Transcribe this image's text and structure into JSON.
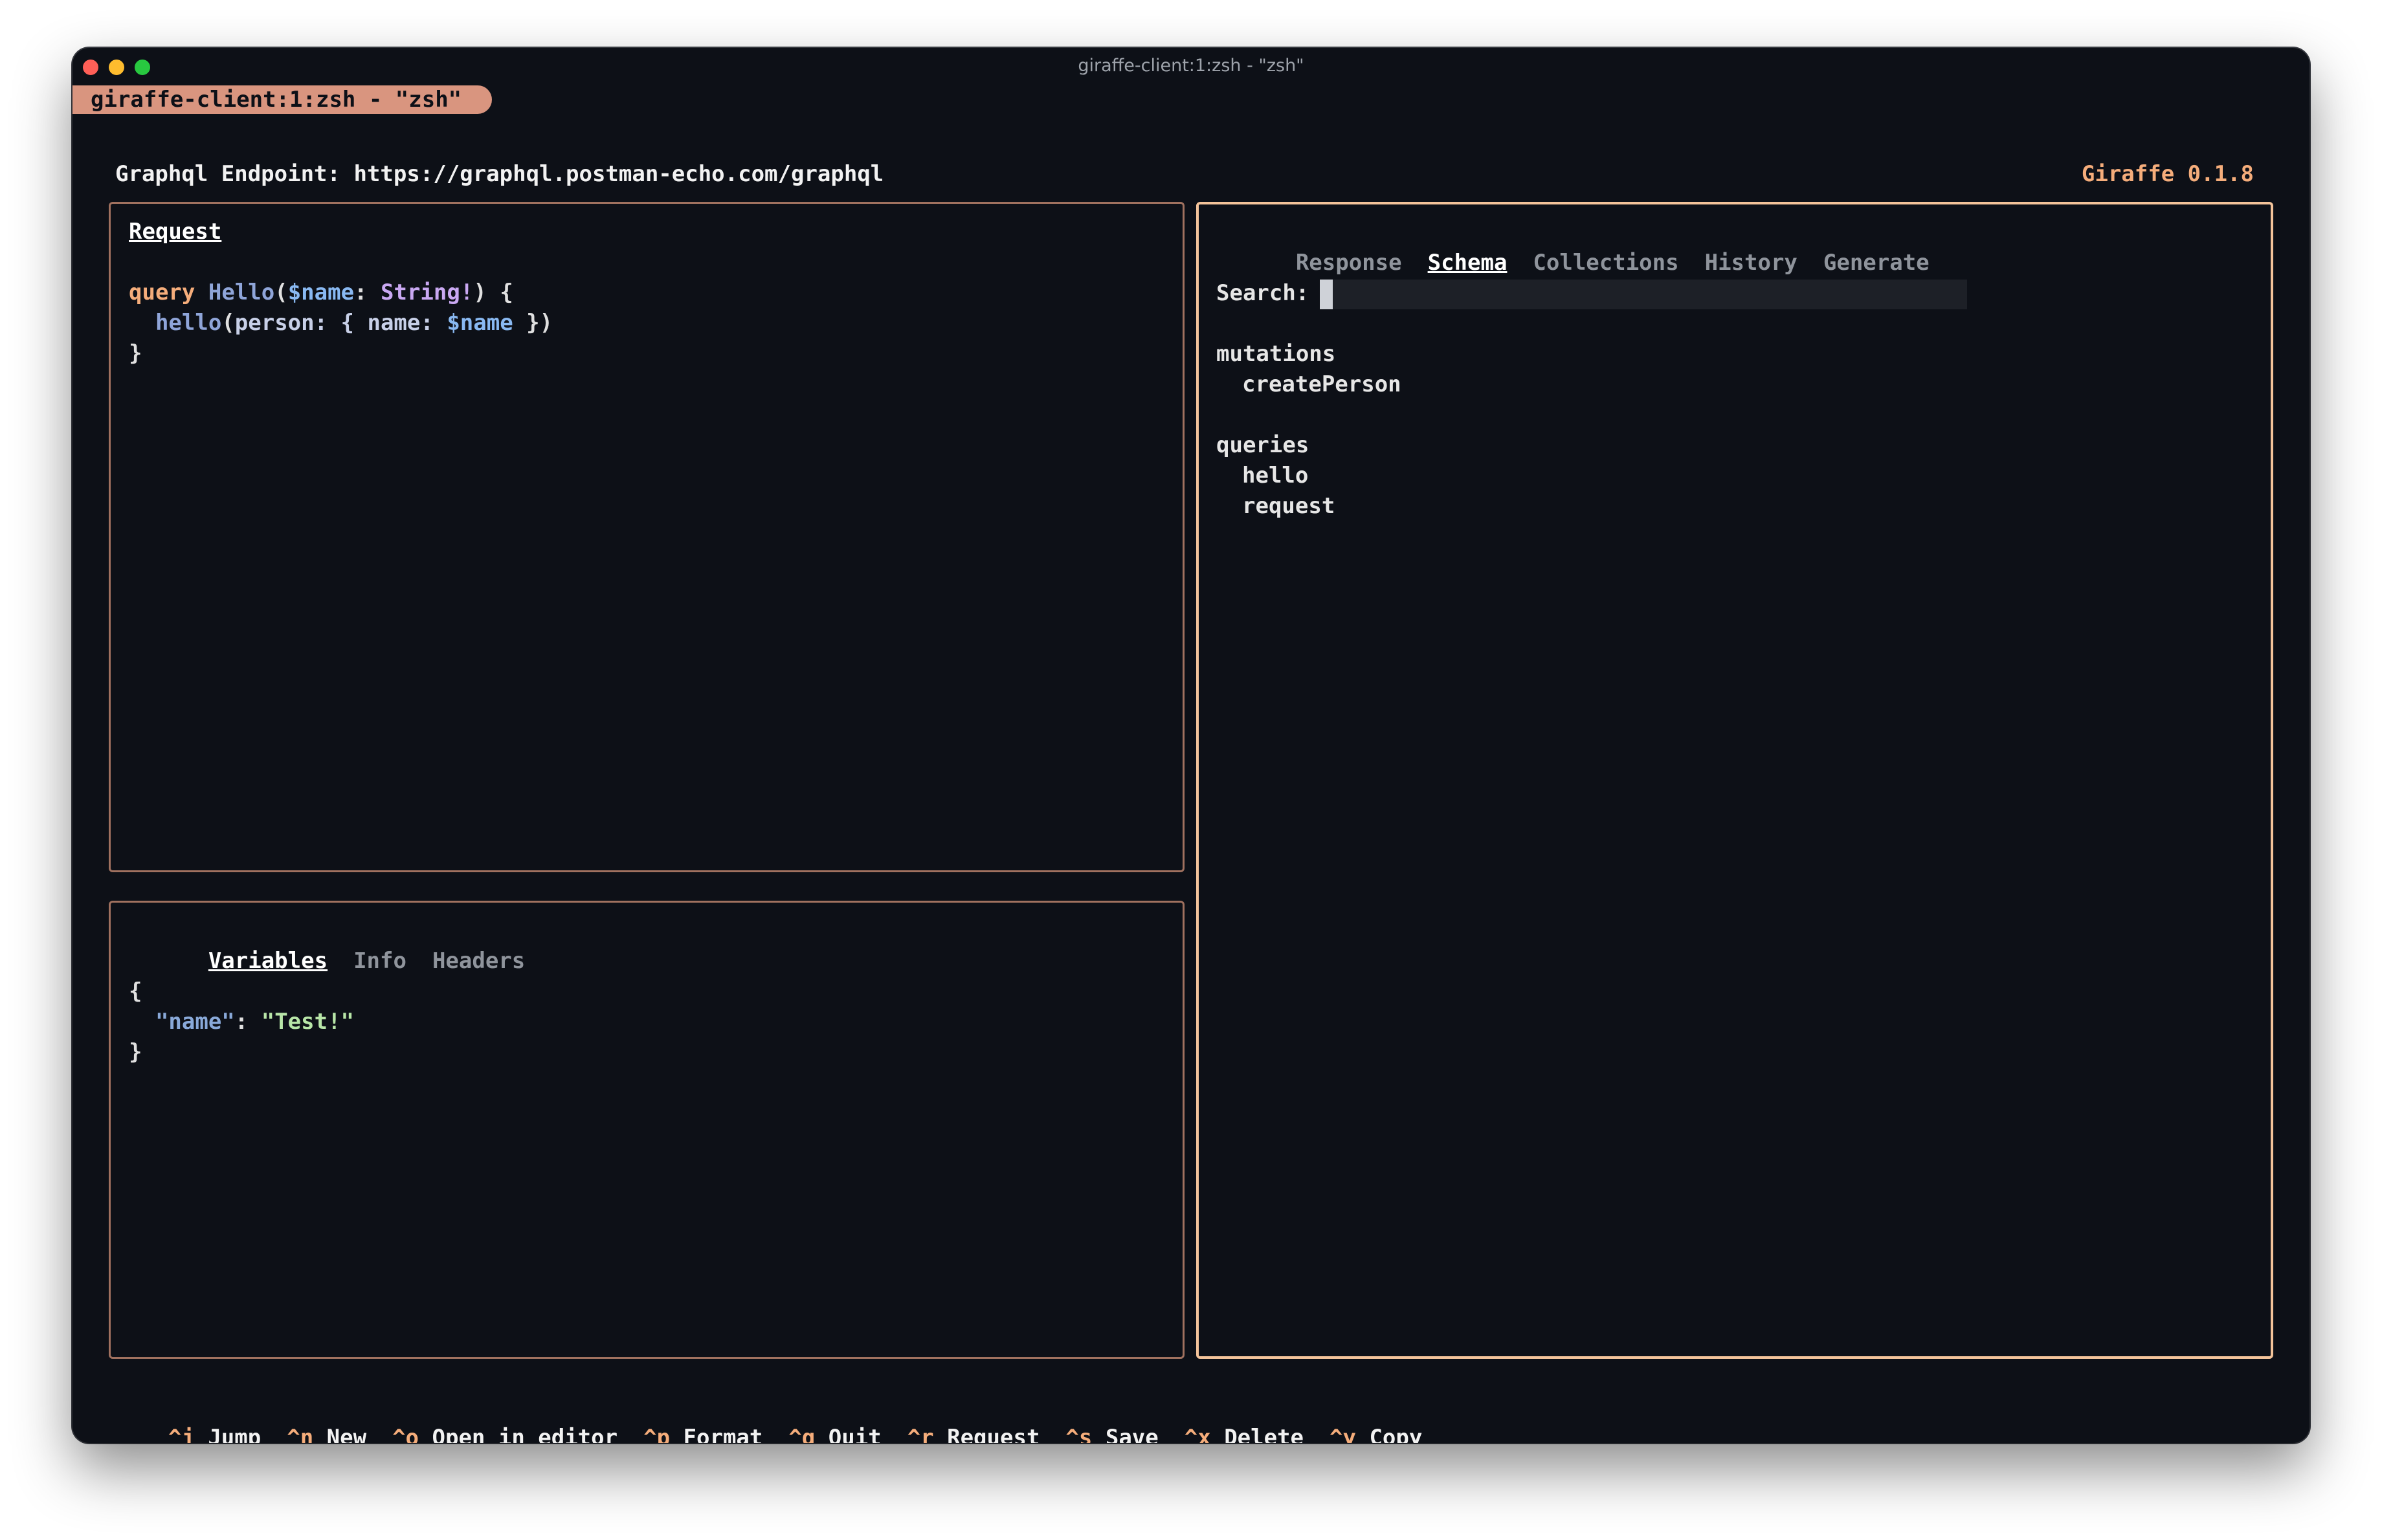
{
  "window": {
    "title": "giraffe-client:1:zsh - \"zsh\""
  },
  "tmux_tab": {
    "label": "giraffe-client:1:zsh - \"zsh\""
  },
  "header": {
    "endpoint_label": "Graphql Endpoint:",
    "endpoint_url": "https://graphql.postman-echo.com/graphql",
    "version": "Giraffe 0.1.8"
  },
  "request": {
    "title": "Request",
    "code": {
      "l1_kw": "query",
      "l1_name": "Hello",
      "l1_paren": "(",
      "l1_var": "$name",
      "l1_colon": ": ",
      "l1_type": "String!",
      "l1_close": ") {",
      "l2_field": "hello",
      "l2_paren": "(",
      "l2_arg": "person: { name: ",
      "l2_var": "$name",
      "l2_close": " })",
      "l3": "}"
    }
  },
  "variables": {
    "tabs": [
      "Variables",
      "Info",
      "Headers"
    ],
    "json": {
      "open": "{",
      "key": "\"name\"",
      "colon": ": ",
      "value": "\"Test!\"",
      "close": "}"
    }
  },
  "response": {
    "tabs": [
      "Response",
      "Schema",
      "Collections",
      "History",
      "Generate"
    ],
    "search_label": "Search:",
    "schema": {
      "mutations_label": "mutations",
      "mutations": [
        "createPerson"
      ],
      "queries_label": "queries",
      "queries": [
        "hello",
        "request"
      ]
    }
  },
  "footer": {
    "shortcuts": [
      {
        "key": "^j",
        "label": "Jump"
      },
      {
        "key": "^n",
        "label": "New"
      },
      {
        "key": "^o",
        "label": "Open in editor"
      },
      {
        "key": "^p",
        "label": "Format"
      },
      {
        "key": "^q",
        "label": "Quit"
      },
      {
        "key": "^r",
        "label": "Request"
      },
      {
        "key": "^s",
        "label": "Save"
      },
      {
        "key": "^x",
        "label": "Delete"
      },
      {
        "key": "^y",
        "label": "Copy"
      }
    ]
  },
  "colors": {
    "accent": "#f5ad7b",
    "border": "#a0715f",
    "active_border": "#f3c39a",
    "background": "#0d1017",
    "tab": "#d9957f"
  }
}
